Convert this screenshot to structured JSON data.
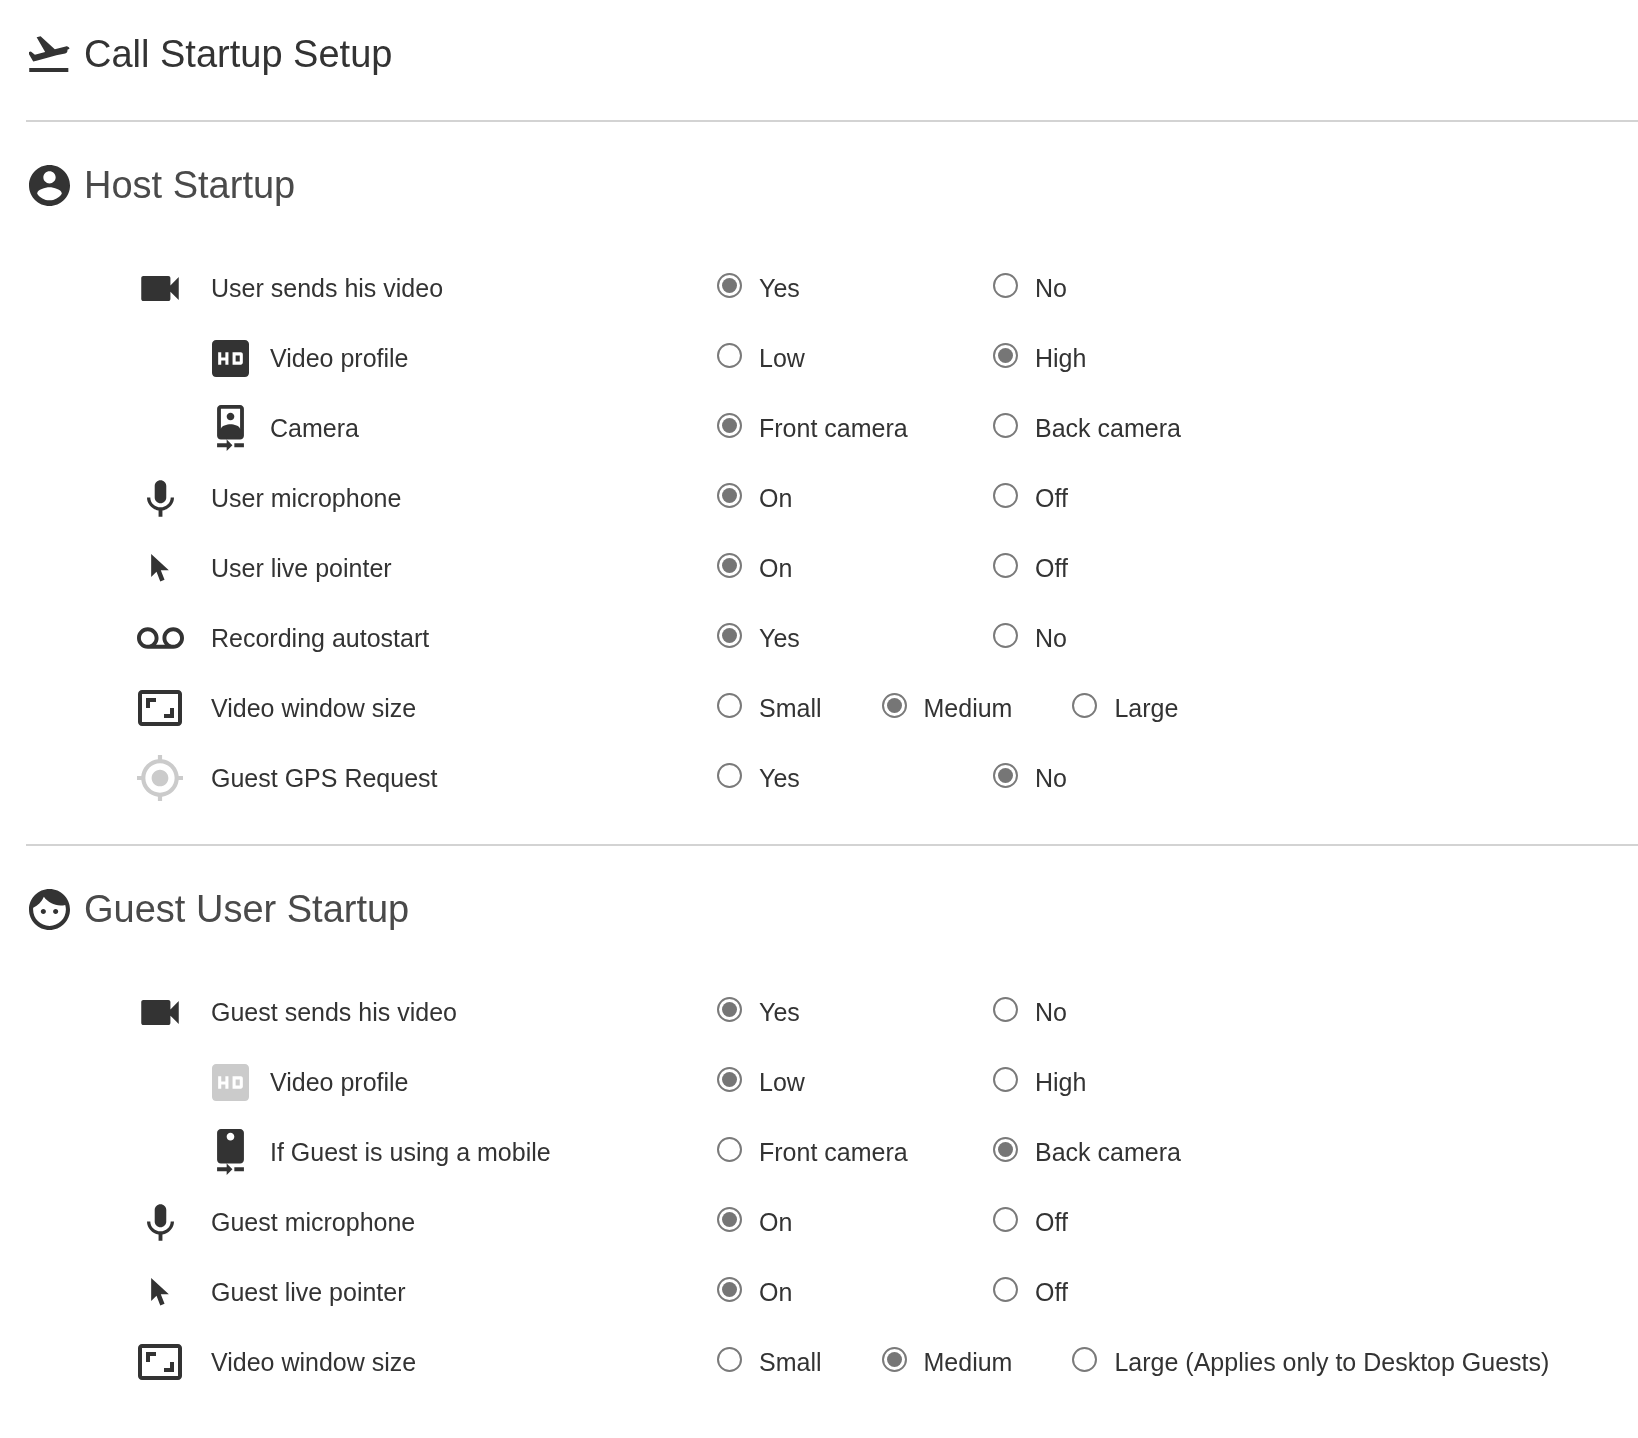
{
  "page": {
    "title": "Call Startup Setup"
  },
  "sections": [
    {
      "title": "Host Startup",
      "kind": "host",
      "settings": [
        {
          "label": "User sends his video",
          "kind": "video",
          "dimmed": false,
          "options": [
            {
              "label": "Yes",
              "selected": true
            },
            {
              "label": "No",
              "selected": false
            }
          ],
          "children": [
            {
              "label": "Video profile",
              "kind": "quality",
              "dimmed": false,
              "options": [
                {
                  "label": "Low",
                  "selected": false
                },
                {
                  "label": "High",
                  "selected": true
                }
              ]
            },
            {
              "label": "Camera",
              "kind": "frontcamera",
              "dimmed": false,
              "options": [
                {
                  "label": "Front camera",
                  "selected": true
                },
                {
                  "label": "Back camera",
                  "selected": false
                }
              ]
            }
          ]
        },
        {
          "label": "User microphone",
          "kind": "microphone",
          "dimmed": false,
          "options": [
            {
              "label": "On",
              "selected": true
            },
            {
              "label": "Off",
              "selected": false
            }
          ]
        },
        {
          "label": "User live pointer",
          "kind": "pointer",
          "dimmed": false,
          "options": [
            {
              "label": "On",
              "selected": true
            },
            {
              "label": "Off",
              "selected": false
            }
          ]
        },
        {
          "label": "Recording autostart",
          "kind": "recording",
          "dimmed": false,
          "options": [
            {
              "label": "Yes",
              "selected": true
            },
            {
              "label": "No",
              "selected": false
            }
          ]
        },
        {
          "label": "Video window size",
          "kind": "window",
          "dimmed": false,
          "options": [
            {
              "label": "Small",
              "selected": false
            },
            {
              "label": "Medium",
              "selected": true
            },
            {
              "label": "Large",
              "selected": false
            }
          ]
        },
        {
          "label": "Guest GPS Request",
          "kind": "location",
          "dimmed": true,
          "options": [
            {
              "label": "Yes",
              "selected": false
            },
            {
              "label": "No",
              "selected": true
            }
          ]
        }
      ]
    },
    {
      "title": "Guest User Startup",
      "kind": "guest",
      "settings": [
        {
          "label": "Guest sends his video",
          "kind": "video",
          "dimmed": false,
          "options": [
            {
              "label": "Yes",
              "selected": true
            },
            {
              "label": "No",
              "selected": false
            }
          ],
          "children": [
            {
              "label": "Video profile",
              "kind": "quality",
              "dimmed": true,
              "options": [
                {
                  "label": "Low",
                  "selected": true
                },
                {
                  "label": "High",
                  "selected": false
                }
              ]
            },
            {
              "label": "If Guest is using a mobile",
              "kind": "rearcamera",
              "dimmed": false,
              "options": [
                {
                  "label": "Front camera",
                  "selected": false
                },
                {
                  "label": "Back camera",
                  "selected": true
                }
              ]
            }
          ]
        },
        {
          "label": "Guest microphone",
          "kind": "microphone",
          "dimmed": false,
          "options": [
            {
              "label": "On",
              "selected": true
            },
            {
              "label": "Off",
              "selected": false
            }
          ]
        },
        {
          "label": "Guest live pointer",
          "kind": "pointer",
          "dimmed": false,
          "options": [
            {
              "label": "On",
              "selected": true
            },
            {
              "label": "Off",
              "selected": false
            }
          ]
        },
        {
          "label": "Video window size",
          "kind": "window",
          "dimmed": false,
          "options": [
            {
              "label": "Small",
              "selected": false
            },
            {
              "label": "Medium",
              "selected": true
            },
            {
              "label": "Large (Applies only to Desktop Guests)",
              "selected": false
            }
          ]
        }
      ]
    }
  ]
}
